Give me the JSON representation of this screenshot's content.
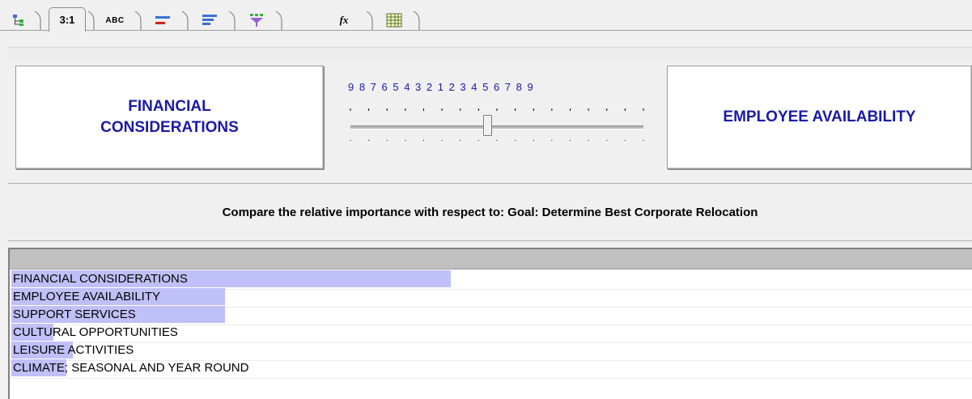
{
  "tabs": {
    "hierarchy_icon": "hierarchy-tree-icon",
    "pairwise_numerical_label": "3:1",
    "verbal_label": "ABC",
    "graphical_icon": "graphical-bars-icon",
    "questionnaire_icon": "questionnaire-lines-icon",
    "filter_icon": "funnel-icon",
    "formula_label": "fx",
    "matrix_icon": "grid-matrix-icon"
  },
  "comparison": {
    "left_element": "FINANCIAL CONSIDERATIONS",
    "right_element": "EMPLOYEE AVAILABILITY",
    "scale_numbers": "9 8 7 6 5 4 3 2 1 2 3 4 5 6 7 8 9",
    "slider_value": 1.5,
    "slider_side": "left",
    "question": "Compare the relative importance with respect to: Goal: Determine Best Corporate Relocation"
  },
  "priorities": [
    {
      "label": "FINANCIAL CONSIDERATIONS",
      "value": 0.457
    },
    {
      "label": "EMPLOYEE AVAILABILITY",
      "value": 0.222
    },
    {
      "label": "SUPPORT SERVICES",
      "value": 0.222
    },
    {
      "label": "CULTURAL OPPORTUNITIES",
      "value": 0.044
    },
    {
      "label": "LEISURE ACTIVITIES",
      "value": 0.064
    },
    {
      "label": "CLIMATE; SEASONAL AND YEAR ROUND",
      "value": 0.057
    }
  ],
  "colors": {
    "element_text": "#1a1aa6",
    "priority_bar": "#c0c0f8"
  }
}
